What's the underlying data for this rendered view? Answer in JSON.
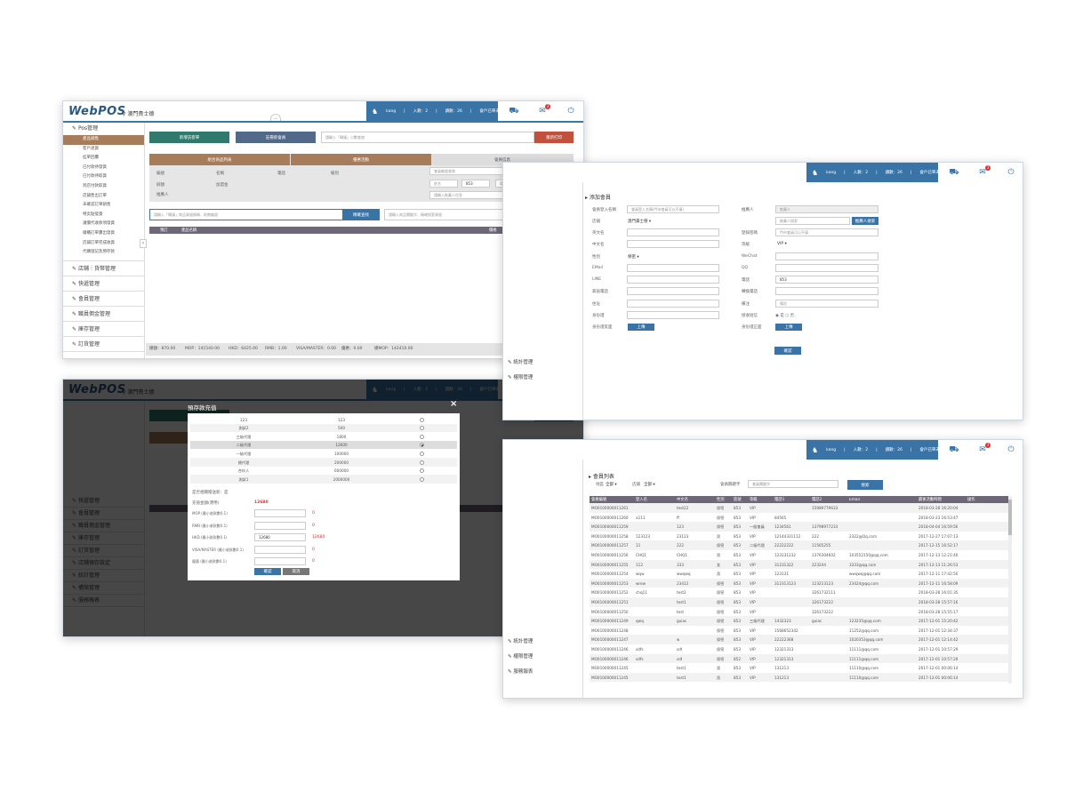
{
  "app": {
    "logo": "WebPOS",
    "store": "澳門貴士德",
    "user": "kang",
    "login_label": "入數：2",
    "visits_label": "讀數：26",
    "orders_label": "會戶已單未取：45",
    "mail_count": "3"
  },
  "screen1": {
    "sidebar": {
      "pos_label": "Pos管理",
      "sub_items": [
        "產品銷售",
        "客戶退貨",
        "挂單回覆",
        "已付款待發貨",
        "已付款待取貨",
        "到店付款取貨",
        "店鋪售出訂單",
        "未確認訂單銷售",
        "特卖點發貨",
        "議價代收款項發貨",
        "總櫃訂單賣出發貨",
        "店鋪訂單完成收貨",
        "代購發記及預存款"
      ],
      "groups": [
        "店鋪｜貨幣管理",
        "快遞管理",
        "會員管理",
        "職員佣金管理",
        "庫存管理",
        "訂貨管理"
      ]
    },
    "buttons": {
      "new_member": "新增訪客單",
      "use_member": "註冊新會員",
      "member_placeholder": "請輸入「轉讓」小數查詢",
      "reprint": "重新打印"
    },
    "tabs": [
      "組合商品列表",
      "優惠活動",
      "會員信息"
    ],
    "info_labels": {
      "a": "編號",
      "b": "名稱",
      "c": "電話",
      "d": "級別",
      "e": "餘額",
      "f": "加盟金",
      "g": "推薦人"
    },
    "right_panel": {
      "search_placeholder": "會員編號查詢",
      "search_btn": "搜索",
      "area_code": "853",
      "phone_placeholder": "電話號碼",
      "name_placeholder": "姓名",
      "confirm": "確定",
      "recommend_placeholder": "請輸入推薦人信息",
      "add": "添加"
    },
    "search1": {
      "placeholder": "請輸入「轉讓」商品貨號條碼、助教編號",
      "btn": "精確查找"
    },
    "search2": {
      "placeholder": "請輸入商品關鍵字、精確搜索貨號",
      "btn": "查找商品/優惠"
    },
    "table_headers": [
      "預訂",
      "產品名稱",
      "價格",
      "操作",
      "件數",
      "操作"
    ],
    "footer": {
      "total": "總額：870.00",
      "mop": "MOP：141540.00",
      "hkd": "HKD：6425.00",
      "rmb": "RMB：1.00",
      "visa": "VISA/MASTER：0.00",
      "other": "優惠：0.00",
      "all": "總MOP：142410.00",
      "checkout": "結算"
    }
  },
  "screen2": {
    "title": "添加會員",
    "left_labels": [
      "會員登入名稱",
      "店鋪",
      "英文名",
      "中文名",
      "性別",
      "EMail",
      "LINE",
      "家居電話",
      "住址",
      "身份證",
      "身份證反面"
    ],
    "left_values": {
      "login_placeholder": "會員登入名稱(門市會員可以不填)",
      "store": "澳門貴士德",
      "gender": "保密",
      "upload": "上傳"
    },
    "right_labels": [
      "推薦人",
      "",
      "登錄密碼",
      "等級",
      "WeChat",
      "QQ",
      "電話",
      "轉換電話",
      "備注",
      "接收短信",
      "身份證正面"
    ],
    "right_values": {
      "recommender": "推薦人",
      "recommender_search": "推薦人搜索",
      "search_btn": "推薦人搜索",
      "password_placeholder": "門市會員可以不填",
      "level": "VIP",
      "area": "853",
      "remark": "備註",
      "sms_yes": "是",
      "sms_no": "否",
      "upload": "上傳"
    },
    "submit": "確認",
    "bottom_groups": [
      "統計管理",
      "權限管理"
    ]
  },
  "screen3": {
    "modal_title": "預存款充值",
    "packages": [
      {
        "name": "123",
        "value": "123",
        "on": false
      },
      {
        "name": "測試2",
        "value": "500",
        "on": false
      },
      {
        "name": "三級代理",
        "value": "1800",
        "on": false
      },
      {
        "name": "二級代理",
        "value": "12600",
        "on": true
      },
      {
        "name": "一級代理",
        "value": "100000",
        "on": false
      },
      {
        "name": "總代理",
        "value": "200000",
        "on": false
      },
      {
        "name": "合伙人",
        "value": "600000",
        "on": false
      },
      {
        "name": "測試1",
        "value": "2000000",
        "on": false
      }
    ],
    "gift_note": "是否相關贈送新：是",
    "amount_label": "充值金額(港幣)",
    "amount_value": "12680",
    "pay_rows": [
      {
        "label": "MOP (最小收款數0.1)",
        "value": "",
        "rest": "0"
      },
      {
        "label": "RMB (最小收款數0.1)",
        "value": "",
        "rest": "0"
      },
      {
        "label": "HKD (最小收款數0.1)",
        "value": "12680",
        "rest": "12680"
      },
      {
        "label": "VISA/MASTER (最小收款數0.1)",
        "value": "",
        "rest": "0"
      },
      {
        "label": "優惠 (最小收款數0.1)",
        "value": "",
        "rest": "0"
      }
    ],
    "ok": "確認",
    "cancel": "取消",
    "bg_groups": [
      "快遞管理",
      "會員管理",
      "職員佣金管理",
      "庫存管理",
      "訂貨管理",
      "店鋪預存設定",
      "統計管理",
      "權限管理",
      "服務報表"
    ]
  },
  "screen4": {
    "title": "會員列表",
    "filter": {
      "area_label": "地區",
      "area_value": "全部",
      "store_label": "店鋪",
      "store_value": "全部",
      "keyword_label": "會員關鍵字",
      "keyword_placeholder": "會員關鍵字",
      "search": "搜索"
    },
    "headers": [
      "會員編號",
      "登入名",
      "中文名",
      "性別",
      "區號",
      "等級",
      "電話1",
      "電話2",
      "Email",
      "最後活動時間",
      "操作"
    ],
    "btn_a": "預金增加",
    "btn_b": "修改",
    "rows": [
      [
        "MO0100000011261",
        "",
        "test22",
        "保密",
        "853",
        "VIP",
        "",
        "15989779633",
        "",
        "2018-03-28 16:20:04"
      ],
      [
        "MO0100000011260",
        "a111",
        "ff",
        "保密",
        "853",
        "VIP",
        "84565",
        "",
        "",
        "2018-03-23 16:53:47"
      ],
      [
        "MO0100000011259",
        "",
        "123",
        "保密",
        "853",
        "一般會員",
        "1234561",
        "13798977233",
        "",
        "2018-04-04 16:59:56"
      ],
      [
        "MO0100000011258",
        "123123",
        "23123",
        "男",
        "853",
        "VIP",
        "12144331112",
        "222",
        "2322@Qq.com",
        "2017-12-27 17:07:13"
      ],
      [
        "MO0100000011257",
        "11",
        "222",
        "保密",
        "853",
        "二級代理",
        "22222222",
        "11565255",
        "",
        "2017-12-15 16:52:17"
      ],
      [
        "MO0100000011256",
        "CHQ1",
        "CHQ1",
        "男",
        "853",
        "VIP",
        "123131232",
        "1376304602",
        "103552150@qq.com",
        "2017-12-13 12:21:40"
      ],
      [
        "MO0100000011255",
        "112",
        "333",
        "女",
        "853",
        "VIP",
        "31231322",
        "223244",
        "3333@qq.com",
        "2017-12-13 11:26:53"
      ],
      [
        "MO0100000011254",
        "wqw",
        "wwqwq",
        "男",
        "853",
        "VIP",
        "123131",
        "",
        "wwqwq@qq.com",
        "2017-12-11 17:42:50"
      ],
      [
        "MO0100000011253",
        "wrew",
        "23412",
        "保密",
        "853",
        "VIP",
        "312313123",
        "123213123",
        "23424@qq.com",
        "2017-12-11 16:58:09"
      ],
      [
        "MO0100000011252",
        "chq11",
        "test2",
        "保密",
        "853",
        "VIP",
        "",
        "3261732111",
        "",
        "2018-03-28 16:01:35"
      ],
      [
        "MO0100000011251",
        "",
        "test1",
        "保密",
        "853",
        "VIP",
        "",
        "326173222",
        "",
        "2018-03-28 15:57:16"
      ],
      [
        "MO0100000011250",
        "",
        "test",
        "保密",
        "853",
        "VIP",
        "",
        "326173222",
        "",
        "2018-03-28 15:55:17"
      ],
      [
        "MO0100000011249",
        "qwq",
        "guiac",
        "保密",
        "853",
        "三級代理",
        "1432323",
        "guiac",
        "123235@qq.com",
        "2017-12-01 15:20:42"
      ],
      [
        "MO0100000011248",
        "",
        "",
        "保密",
        "853",
        "VIP",
        "1568652342",
        "",
        "11252@qq.com",
        "2017-12-01 12:34:37"
      ],
      [
        "MO0100000011247",
        "",
        "w",
        "保密",
        "853",
        "VIP",
        "22222368",
        "",
        "1020353@qq.com",
        "2017-12-01 12:14:42"
      ],
      [
        "MO0100000011246",
        "sdfs",
        "sdf",
        "保密",
        "853",
        "VIP",
        "12321313",
        "",
        "11111@qq.com",
        "2017-12-01 10:57:29"
      ],
      [
        "MO0100000011246",
        "sdfs",
        "sdf",
        "保密",
        "852",
        "VIP",
        "12321313",
        "",
        "11111@qq.com",
        "2017-12-01 10:57:29"
      ],
      [
        "MO0100000011245",
        "",
        "test1",
        "男",
        "853",
        "VIP",
        "131213",
        "",
        "11110@qq.com",
        "2017-12-01 00:06:14"
      ],
      [
        "MO0100000011245",
        "",
        "test1",
        "男",
        "853",
        "VIP",
        "131213",
        "",
        "11110@qq.com",
        "2017-12-01 00:06:14"
      ]
    ],
    "side_groups": [
      "統計管理",
      "權限管理",
      "服務報表"
    ]
  }
}
